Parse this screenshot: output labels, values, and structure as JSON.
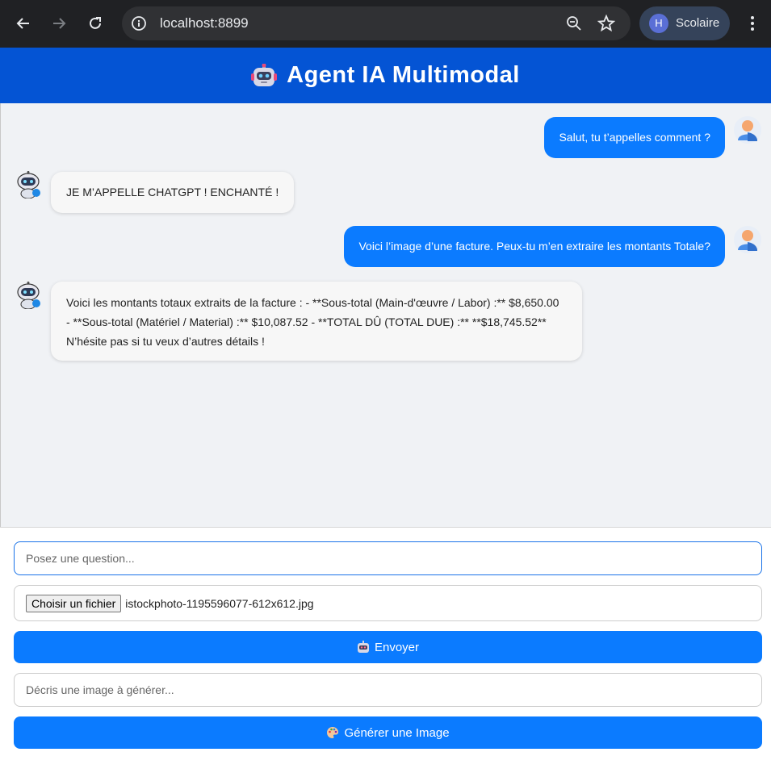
{
  "browser": {
    "url": "localhost:8899",
    "profile_initial": "H",
    "profile_name": "Scolaire"
  },
  "app": {
    "title": "Agent IA Multimodal",
    "header_color": "#0454d4"
  },
  "messages": [
    {
      "role": "user",
      "text": "Salut, tu t’appelles comment ?"
    },
    {
      "role": "bot",
      "text": "JE M’APPELLE CHATGPT ! ENCHANTÉ !"
    },
    {
      "role": "user",
      "text": "Voici l’image d’une facture. Peux-tu m’en extraire les montants Totale?"
    },
    {
      "role": "bot",
      "lines": [
        "Voici les montants totaux extraits de la facture : - **Sous-total (Main-d'œuvre / Labor) :** $8,650.00",
        "- **Sous-total (Matériel / Material) :** $10,087.52 - **TOTAL DÛ (TOTAL DUE) :** **$18,745.52**",
        "N’hésite pas si tu veux d’autres détails !"
      ]
    }
  ],
  "form": {
    "question_placeholder": "Posez une question...",
    "file_button_label": "Choisir un fichier",
    "file_name": "istockphoto-1195596077-612x612.jpg",
    "send_label": "Envoyer",
    "image_prompt_placeholder": "Décris une image à générer...",
    "generate_label": "Générer une Image"
  },
  "colors": {
    "accent": "#0b7bff",
    "chat_bg": "#f0f2f5"
  },
  "icons": {
    "back": "arrow-left-icon",
    "forward": "arrow-right-icon",
    "reload": "reload-icon",
    "site_info": "site-info-icon",
    "zoom": "zoom-out-icon",
    "bookmark": "star-icon",
    "menu": "kebab-menu-icon",
    "app_logo": "robot-icon",
    "user_avatar": "user-avatar-icon",
    "bot_avatar": "bot-avatar-icon",
    "send": "robot-icon",
    "generate": "palette-icon"
  }
}
